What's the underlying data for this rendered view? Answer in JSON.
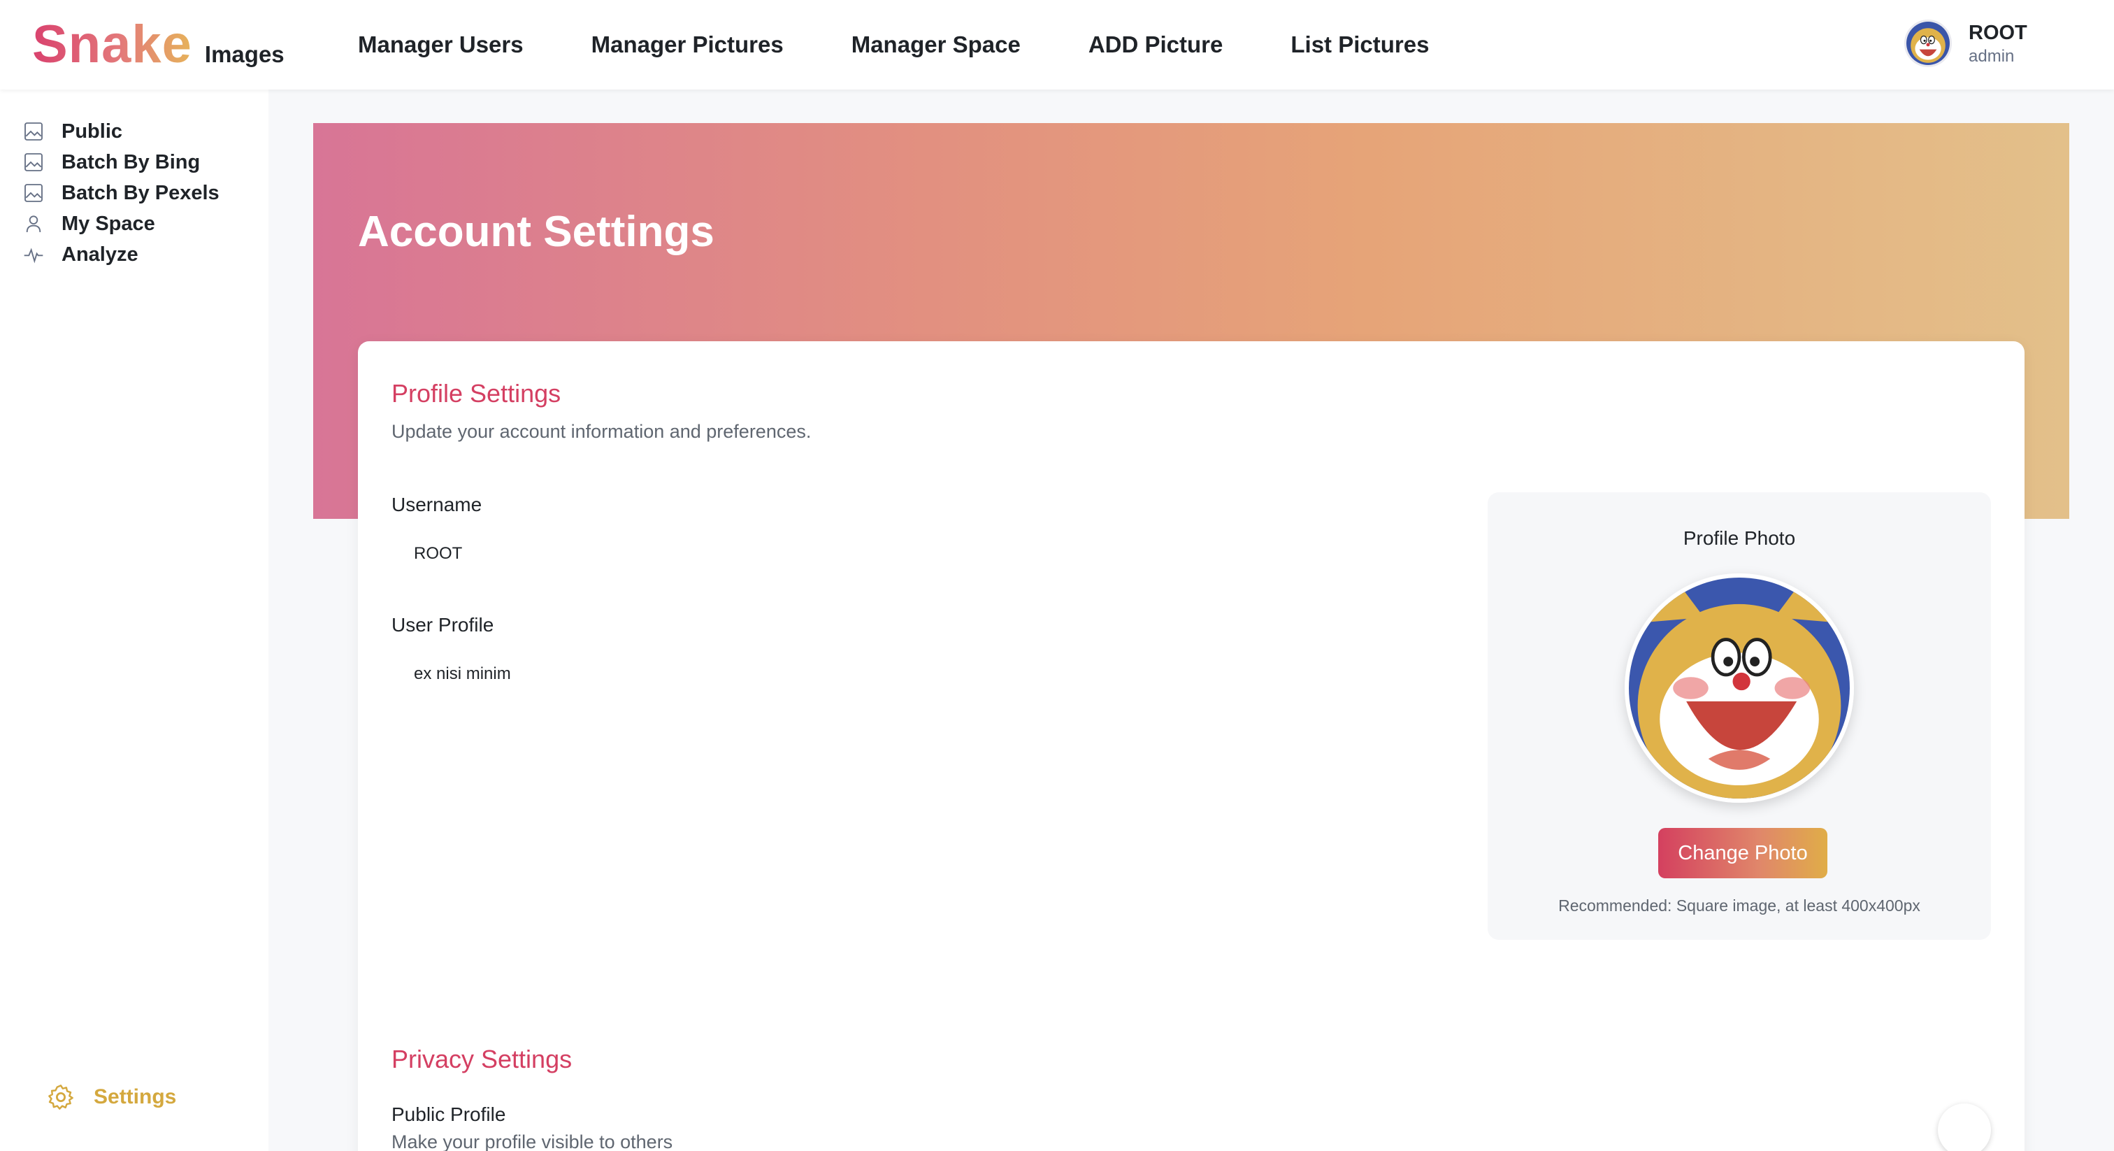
{
  "logo": {
    "brand": "Snake",
    "suffix": "Images"
  },
  "topnav": {
    "items": [
      {
        "label": "Manager Users"
      },
      {
        "label": "Manager Pictures"
      },
      {
        "label": "Manager Space"
      },
      {
        "label": "ADD Picture"
      },
      {
        "label": "List Pictures"
      }
    ]
  },
  "user": {
    "name": "ROOT",
    "role": "admin",
    "avatar_icon": "cartoon-cat-avatar"
  },
  "sidebar": {
    "items": [
      {
        "label": "Public",
        "icon": "image-icon"
      },
      {
        "label": "Batch By Bing",
        "icon": "image-icon"
      },
      {
        "label": "Batch By Pexels",
        "icon": "image-icon"
      },
      {
        "label": "My Space",
        "icon": "user-icon"
      },
      {
        "label": "Analyze",
        "icon": "pulse-icon"
      }
    ],
    "settings_label": "Settings",
    "settings_icon": "gear-icon"
  },
  "banner": {
    "title": "Account Settings"
  },
  "profile": {
    "title": "Profile Settings",
    "subtitle": "Update your account information and preferences.",
    "username_label": "Username",
    "username_value": "ROOT",
    "profile_label": "User Profile",
    "profile_value": "ex nisi minim",
    "photo_label": "Profile Photo",
    "change_photo": "Change Photo",
    "photo_note": "Recommended: Square image, at least 400x400px"
  },
  "privacy": {
    "title": "Privacy Settings",
    "public_profile_label": "Public Profile",
    "public_profile_desc": "Make your profile visible to others"
  },
  "colors": {
    "accent": "#d43f62",
    "gold": "#d4a83e",
    "banner_start": "#d87596",
    "banner_end": "#e3c08a"
  }
}
